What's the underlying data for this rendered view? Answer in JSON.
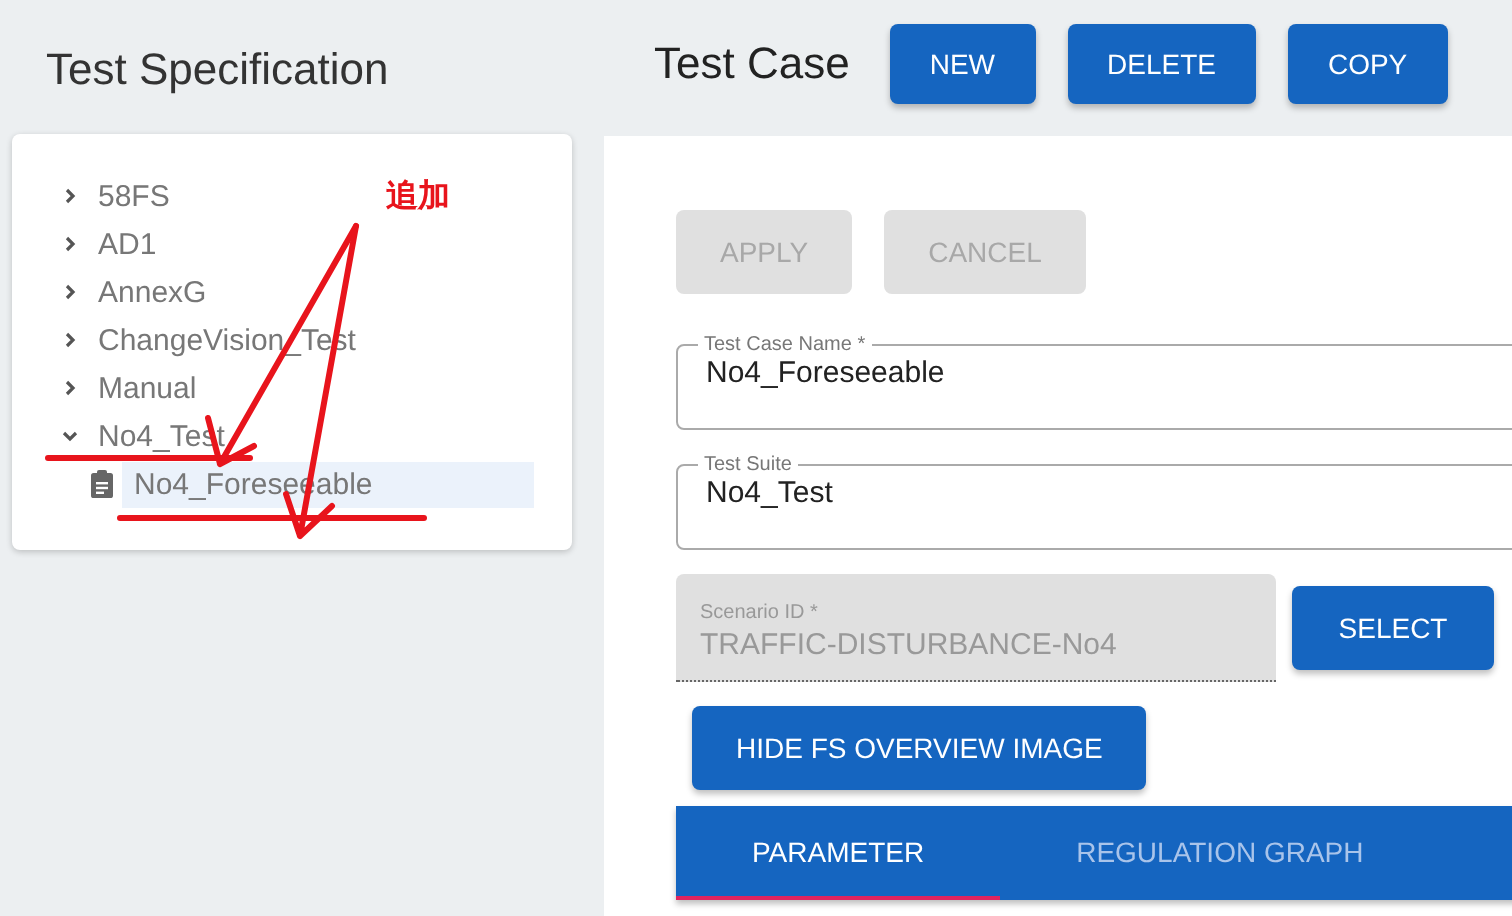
{
  "sidebar": {
    "title": "Test Specification",
    "tree": [
      {
        "label": "58FS",
        "expanded": false,
        "selected": false
      },
      {
        "label": "AD1",
        "expanded": false,
        "selected": false
      },
      {
        "label": "AnnexG",
        "expanded": false,
        "selected": false
      },
      {
        "label": "ChangeVision_Test",
        "expanded": false,
        "selected": false
      },
      {
        "label": "Manual",
        "expanded": false,
        "selected": false
      },
      {
        "label": "No4_Test",
        "expanded": true,
        "selected": false,
        "children": [
          {
            "label": "No4_Foreseeable",
            "selected": true
          }
        ]
      }
    ]
  },
  "header": {
    "title": "Test Case",
    "buttons": [
      "NEW",
      "DELETE",
      "COPY"
    ]
  },
  "form": {
    "actions": [
      {
        "label": "APPLY",
        "disabled": true
      },
      {
        "label": "CANCEL",
        "disabled": true
      }
    ],
    "fields": [
      {
        "label": "Test Case Name *",
        "value": "No4_Foreseeable",
        "disabled": false
      },
      {
        "label": "Test Suite",
        "value": "No4_Test",
        "disabled": false
      },
      {
        "label": "Scenario ID *",
        "value": "TRAFFIC-DISTURBANCE-No4",
        "disabled": true
      }
    ],
    "select_button": "SELECT",
    "toggle_button": "HIDE FS OVERVIEW IMAGE",
    "tabs": [
      {
        "label": "PARAMETER",
        "selected": true
      },
      {
        "label": "REGULATION GRAPH",
        "selected": false
      }
    ]
  },
  "annotation": {
    "text": "追加"
  }
}
